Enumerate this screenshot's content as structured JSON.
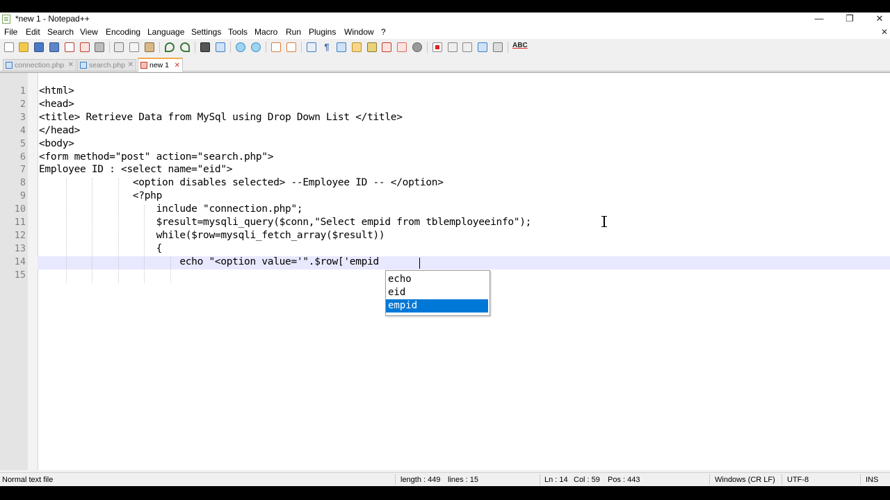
{
  "window": {
    "title": "*new 1 - Notepad++",
    "controls": {
      "minimize": "—",
      "restore": "❐",
      "close": "✕"
    }
  },
  "menu": {
    "items": [
      "File",
      "Edit",
      "Search",
      "View",
      "Encoding",
      "Language",
      "Settings",
      "Tools",
      "Macro",
      "Run",
      "Plugins",
      "Window",
      "?"
    ],
    "doc_close": "✕"
  },
  "toolbar": {
    "spellcheck_label": "ABC"
  },
  "tabs": [
    {
      "label": "connection.php",
      "close": "✕",
      "active": false
    },
    {
      "label": "search.php",
      "close": "✕",
      "active": false
    },
    {
      "label": "new 1",
      "close": "✕",
      "active": true
    }
  ],
  "editor": {
    "line_numbers": [
      "1",
      "2",
      "3",
      "4",
      "5",
      "6",
      "7",
      "8",
      "9",
      "10",
      "11",
      "12",
      "13",
      "14",
      "15"
    ],
    "lines": [
      "<html>",
      "<head>",
      "<title> Retrieve Data from MySql using Drop Down List </title>",
      "</head>",
      "<body>",
      "<form method=\"post\" action=\"search.php\">",
      "Employee ID : <select name=\"eid\">",
      "                <option disables selected> --Employee ID -- </option>",
      "                <?php",
      "                    include \"connection.php\";",
      "                    $result=mysqli_query($conn,\"Select empid from tblemployeeinfo\");",
      "                    while($row=mysqli_fetch_array($result))",
      "                    {",
      "                        echo \"<option value='\".$row['empid",
      ""
    ],
    "current_line": 14
  },
  "autocomplete": {
    "items": [
      "echo",
      "eid",
      "empid"
    ],
    "selected": "empid"
  },
  "status": {
    "file_type": "Normal text file",
    "length": "length : 449",
    "lines": "lines : 15",
    "ln": "Ln : 14",
    "col": "Col : 59",
    "pos": "Pos : 443",
    "eol": "Windows (CR LF)",
    "encoding": "UTF-8",
    "mode": "INS"
  },
  "colors": {
    "current_line_bg": "#e8e8ff",
    "selection_blue": "#0078d7",
    "active_tab_accent": "#f7a94b"
  }
}
